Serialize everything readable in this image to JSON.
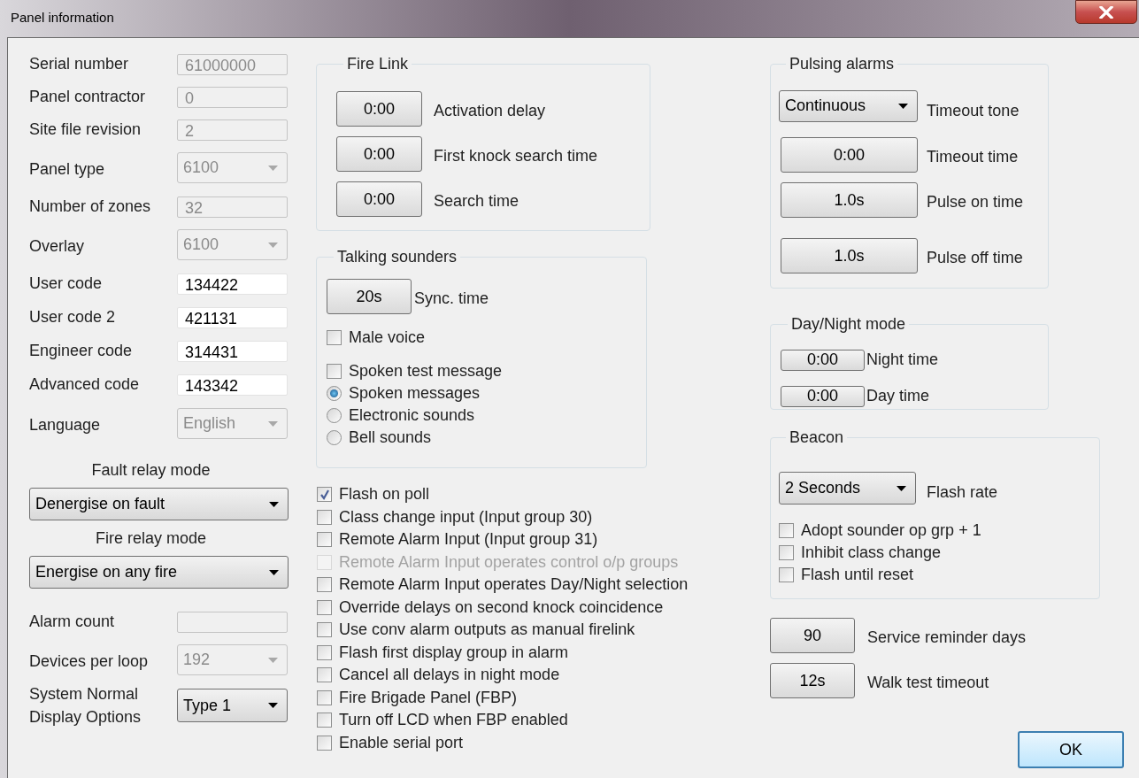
{
  "window": {
    "title": "Panel information"
  },
  "panel_fields": [
    {
      "kind": "text",
      "label": "Serial number",
      "value": "61000000",
      "disabled": true
    },
    {
      "kind": "text",
      "label": "Panel contractor",
      "value": "0",
      "disabled": true
    },
    {
      "kind": "text",
      "label": "Site file revision",
      "value": "2",
      "disabled": true
    },
    {
      "kind": "combo",
      "label": "Panel type",
      "value": "6100",
      "disabled": true
    },
    {
      "kind": "text",
      "label": "Number of zones",
      "value": "32",
      "disabled": true
    },
    {
      "kind": "combo",
      "label": "Overlay",
      "value": "6100",
      "disabled": true
    },
    {
      "kind": "code",
      "label": "User code",
      "value": "134422",
      "disabled": false
    },
    {
      "kind": "code",
      "label": "User code 2",
      "value": "421131",
      "disabled": false
    },
    {
      "kind": "code",
      "label": "Engineer code",
      "value": "314431",
      "disabled": false
    },
    {
      "kind": "code",
      "label": "Advanced code",
      "value": "143342",
      "disabled": false
    },
    {
      "kind": "combo",
      "label": "Language",
      "value": "English",
      "disabled": true
    }
  ],
  "relay_modes": [
    {
      "label": "Fault relay mode",
      "value": "Denergise on fault"
    },
    {
      "label": "Fire relay mode",
      "value": "Energise on any fire"
    }
  ],
  "more_fields": [
    {
      "kind": "text",
      "label": "Alarm count",
      "disabled": true
    },
    {
      "kind": "combo",
      "label": "Devices per loop",
      "value": "192",
      "disabled": true
    },
    {
      "kind": "combo",
      "label": "System Normal Display Options",
      "value": "Type 1",
      "disabled": false
    }
  ],
  "fire_link": {
    "title": "Fire Link",
    "rows": [
      {
        "value": "0:00",
        "label": "Activation delay"
      },
      {
        "value": "0:00",
        "label": "First knock search time"
      },
      {
        "value": "0:00",
        "label": "Search time"
      }
    ]
  },
  "talking_sounders": {
    "title": "Talking sounders",
    "sync": {
      "value": "20s",
      "label": "Sync. time"
    },
    "options": [
      {
        "kind": "checkbox",
        "label": "Male voice",
        "checked": false
      },
      {
        "kind": "checkbox",
        "label": "Spoken test message",
        "checked": false
      },
      {
        "kind": "radio",
        "label": "Spoken messages",
        "selected": true
      },
      {
        "kind": "radio",
        "label": "Electronic sounds",
        "selected": false
      },
      {
        "kind": "radio",
        "label": "Bell sounds",
        "selected": false
      }
    ]
  },
  "options": [
    {
      "label": "Flash on poll",
      "checked": true,
      "disabled": false
    },
    {
      "label": "Class change input (Input group 30)",
      "checked": false,
      "disabled": false
    },
    {
      "label": "Remote Alarm Input (Input group 31)",
      "checked": false,
      "disabled": false
    },
    {
      "label": "Remote Alarm Input operates control o/p groups",
      "checked": false,
      "disabled": true
    },
    {
      "label": "Remote Alarm Input operates Day/Night selection",
      "checked": false,
      "disabled": false
    },
    {
      "label": "Override delays on second knock coincidence",
      "checked": false,
      "disabled": false
    },
    {
      "label": "Use conv alarm outputs as manual firelink",
      "checked": false,
      "disabled": false
    },
    {
      "label": "Flash first display group in alarm",
      "checked": false,
      "disabled": false
    },
    {
      "label": "Cancel all delays in night mode",
      "checked": false,
      "disabled": false
    },
    {
      "label": "Fire Brigade Panel (FBP)",
      "checked": false,
      "disabled": false
    },
    {
      "label": "Turn off LCD when FBP enabled",
      "checked": false,
      "disabled": false
    },
    {
      "label": "Enable serial port",
      "checked": false,
      "disabled": false
    }
  ],
  "pulsing_alarms": {
    "title": "Pulsing alarms",
    "rows": [
      {
        "kind": "combo",
        "value": "Continuous",
        "label": "Timeout tone"
      },
      {
        "kind": "button",
        "value": "0:00",
        "label": "Timeout time"
      },
      {
        "kind": "button",
        "value": "1.0s",
        "label": "Pulse on time"
      },
      {
        "kind": "button",
        "value": "1.0s",
        "label": "Pulse off time"
      }
    ]
  },
  "day_night": {
    "title": "Day/Night mode",
    "rows": [
      {
        "value": "0:00",
        "label": "Night time"
      },
      {
        "value": "0:00",
        "label": "Day time"
      }
    ]
  },
  "beacon": {
    "title": "Beacon",
    "flash_rate": {
      "value": "2 Seconds",
      "label": "Flash rate"
    },
    "options": [
      {
        "label": "Adopt sounder op grp + 1",
        "checked": false
      },
      {
        "label": "Inhibit class change",
        "checked": false
      },
      {
        "label": "Flash until reset",
        "checked": false
      }
    ]
  },
  "timers": [
    {
      "value": "90",
      "label": "Service reminder days"
    },
    {
      "value": "12s",
      "label": "Walk test timeout"
    }
  ],
  "ok_button": "OK"
}
